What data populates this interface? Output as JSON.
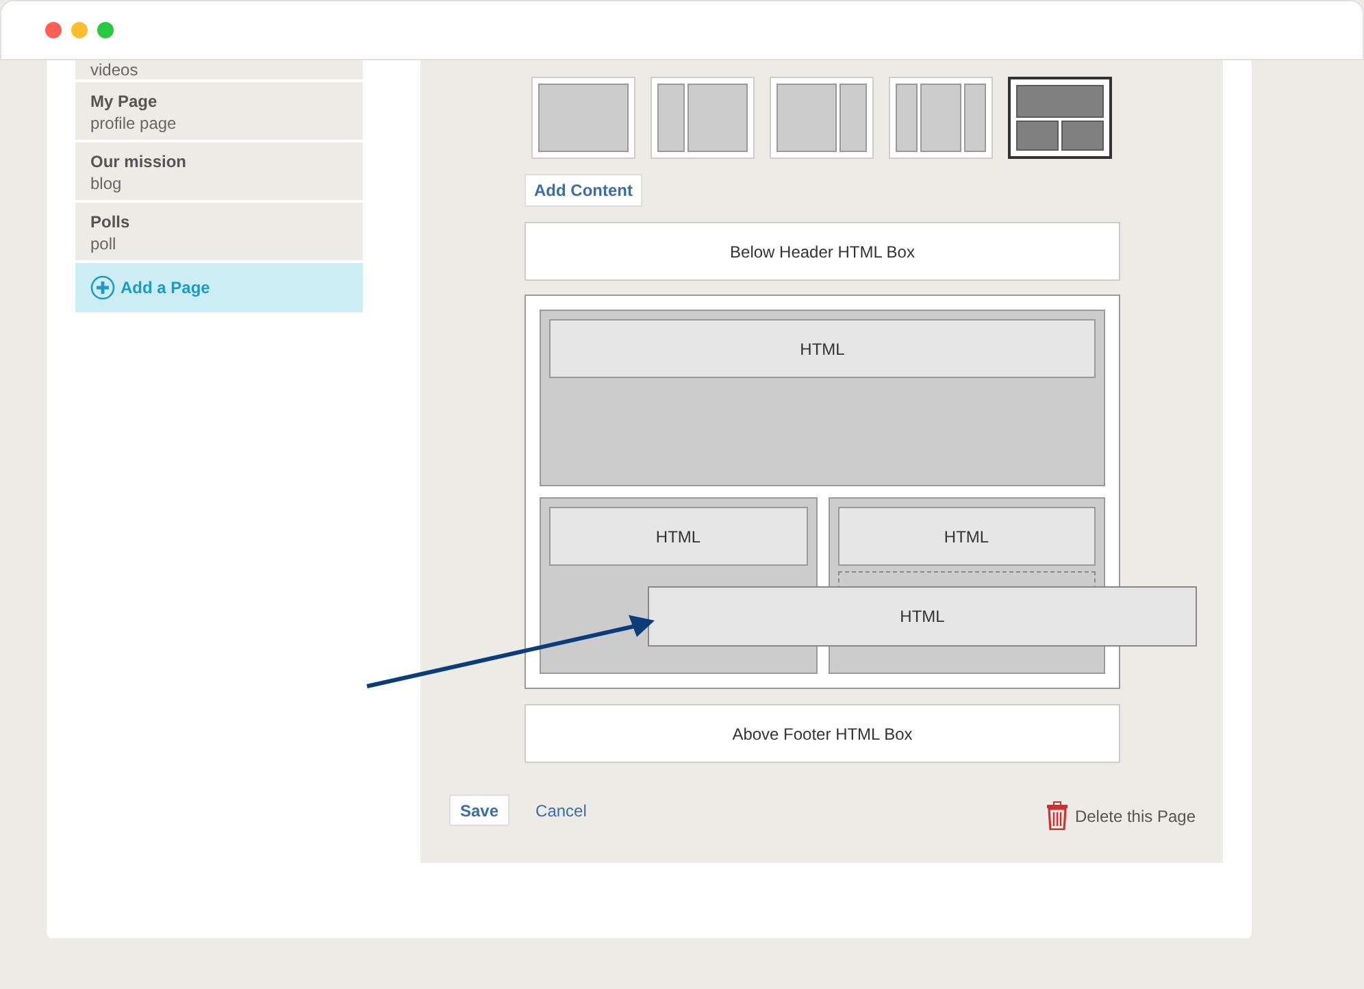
{
  "sidebar": {
    "items": [
      {
        "subtitle": "videos"
      },
      {
        "title": "My Page",
        "subtitle": "profile page"
      },
      {
        "title": "Our mission",
        "subtitle": "blog"
      },
      {
        "title": "Polls",
        "subtitle": "poll"
      }
    ],
    "add_button": "Add a Page"
  },
  "layouts": [
    {
      "kind": "single",
      "selected": false
    },
    {
      "kind": "left-sidebar",
      "selected": false
    },
    {
      "kind": "right-sidebar",
      "selected": false
    },
    {
      "kind": "three-column",
      "selected": false
    },
    {
      "kind": "top-two",
      "selected": true
    }
  ],
  "add_content": "Add Content",
  "header_box": "Below Header HTML Box",
  "canvas": {
    "top": [
      {
        "label": "HTML"
      }
    ],
    "columns": [
      {
        "widgets": [
          {
            "label": "HTML"
          }
        ],
        "drop_placeholder": false
      },
      {
        "widgets": [
          {
            "label": "HTML"
          }
        ],
        "drop_placeholder": true
      }
    ],
    "dragged": {
      "label": "HTML"
    }
  },
  "footer_box": "Above Footer HTML Box",
  "save": "Save",
  "cancel": "Cancel",
  "delete": "Delete this Page"
}
